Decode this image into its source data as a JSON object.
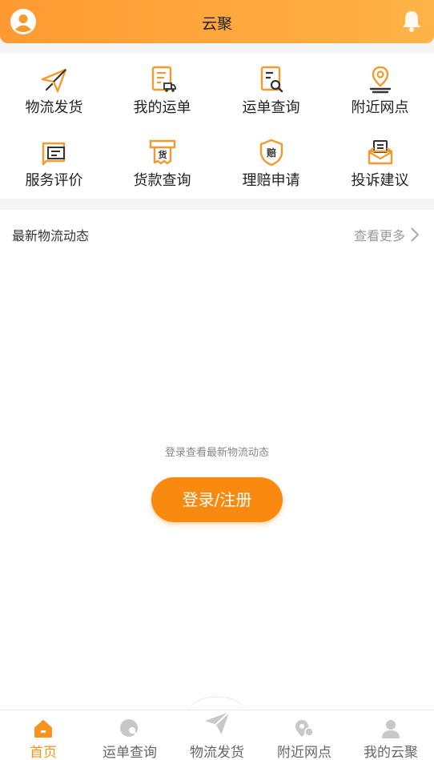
{
  "header": {
    "title": "云聚"
  },
  "services": [
    {
      "label": "物流发货",
      "icon": "paper-plane-icon"
    },
    {
      "label": "我的运单",
      "icon": "waybill-truck-icon"
    },
    {
      "label": "运单查询",
      "icon": "document-search-icon"
    },
    {
      "label": "附近网点",
      "icon": "location-pin-icon"
    },
    {
      "label": "服务评价",
      "icon": "review-message-icon"
    },
    {
      "label": "货款查询",
      "icon": "payment-goods-icon"
    },
    {
      "label": "理赔申请",
      "icon": "claim-shield-icon"
    },
    {
      "label": "投诉建议",
      "icon": "complaint-inbox-icon"
    }
  ],
  "news": {
    "title": "最新物流动态",
    "more": "查看更多",
    "empty_text": "登录查看最新物流动态",
    "login_button": "登录/注册"
  },
  "tabbar": {
    "items": [
      {
        "label": "首页",
        "icon": "home-icon",
        "active": true
      },
      {
        "label": "运单查询",
        "icon": "waybill-query-icon",
        "active": false
      },
      {
        "label": "物流发货",
        "icon": "paper-plane-icon",
        "active": false
      },
      {
        "label": "附近网点",
        "icon": "nearby-location-icon",
        "active": false
      },
      {
        "label": "我的云聚",
        "icon": "user-icon",
        "active": false
      }
    ]
  },
  "colors": {
    "accent": "#f7931e",
    "header_start": "#ff9a32",
    "header_end": "#ffb347",
    "button": "#f98a0f"
  }
}
